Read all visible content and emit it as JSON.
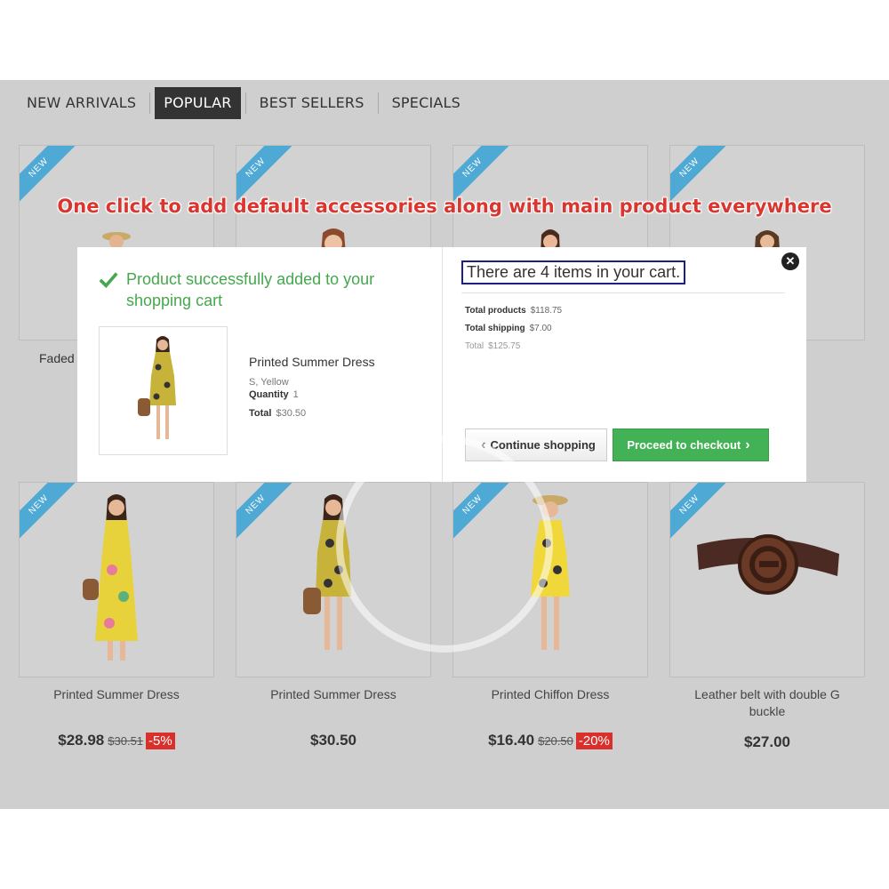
{
  "tabs": [
    {
      "label": "NEW ARRIVALS",
      "active": false
    },
    {
      "label": "POPULAR",
      "active": true
    },
    {
      "label": "BEST SELLERS",
      "active": false
    },
    {
      "label": "SPECIALS",
      "active": false
    }
  ],
  "headline": "One click to add default accessories along with main product everywhere",
  "badge_label": "NEW",
  "top_products": [
    {
      "name": "Faded"
    }
  ],
  "products": [
    {
      "name": "Printed Summer Dress",
      "price": "$28.98",
      "old_price": "$30.51",
      "discount": "-5%"
    },
    {
      "name": "Printed Summer Dress",
      "price": "$30.50",
      "old_price": "",
      "discount": ""
    },
    {
      "name": "Printed Chiffon Dress",
      "price": "$16.40",
      "old_price": "$20.50",
      "discount": "-20%"
    },
    {
      "name": "Leather belt with double G buckle",
      "price": "$27.00",
      "old_price": "",
      "discount": ""
    }
  ],
  "modal": {
    "success_message": "Product successfully added to your shopping cart",
    "product_name": "Printed Summer Dress",
    "attributes": "S, Yellow",
    "quantity_label": "Quantity",
    "quantity_value": "1",
    "total_label": "Total",
    "total_value": "$30.50",
    "cart_count_text": "There are 4 items in your cart.",
    "total_products_label": "Total products",
    "total_products_value": "$118.75",
    "total_shipping_label": "Total shipping",
    "total_shipping_value": "$7.00",
    "grand_total_label": "Total",
    "grand_total_value": "$125.75",
    "continue_label": "Continue shopping",
    "checkout_label": "Proceed to checkout"
  },
  "colors": {
    "accent_green": "#46a74e",
    "badge_blue": "#4ea9d4",
    "discount_red": "#d9302b",
    "headline_red": "#d9362f"
  }
}
